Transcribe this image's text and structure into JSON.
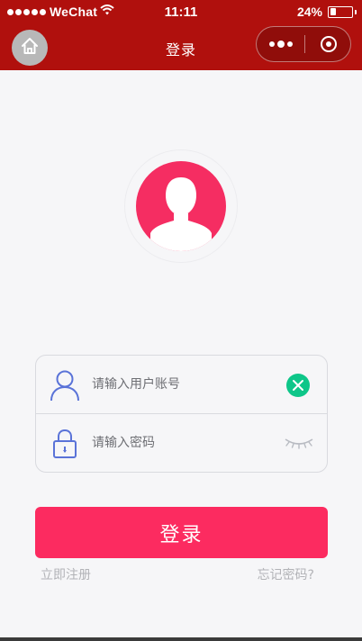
{
  "status_bar": {
    "carrier": "WeChat",
    "time": "11:11",
    "battery_text": "24%",
    "battery_level": 0.24,
    "signal_dots": 5
  },
  "nav": {
    "title": "登录",
    "home_icon": "home-icon",
    "more_icon": "more-dots-icon",
    "close_icon": "target-close-icon"
  },
  "avatar": {
    "icon": "person-silhouette-icon",
    "color": "#f52d62"
  },
  "form": {
    "username_placeholder": "请输入用户账号",
    "username_value": "",
    "password_placeholder": "请输入密码",
    "password_value": "",
    "user_icon": "user-icon",
    "lock_icon": "lock-icon",
    "clear_icon": "clear-x-icon",
    "eye_icon": "eye-closed-icon"
  },
  "actions": {
    "login_label": "登录",
    "register_label": "立即注册",
    "forgot_label": "忘记密码?"
  },
  "colors": {
    "header": "#b0100d",
    "accent": "#fc2b60",
    "clear": "#0ec689",
    "icon_blue": "#5a73d8",
    "link": "#b2b3b7"
  }
}
